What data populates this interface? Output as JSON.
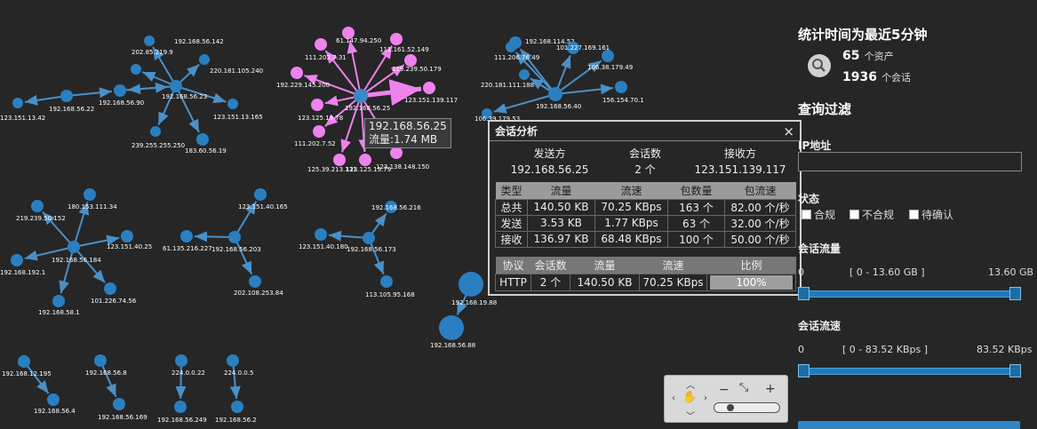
{
  "graph": {
    "nodes": [
      {
        "id": "n1",
        "label": "192.168.56.142",
        "color": "#2a7fc1"
      },
      {
        "id": "n2",
        "label": "202.85.219.9",
        "color": "#2a7fc1"
      },
      {
        "id": "n3",
        "label": "220.181.105.240",
        "color": "#2a7fc1"
      },
      {
        "id": "n4",
        "label": "192.168.56.23",
        "color": "#2a7fc1"
      },
      {
        "id": "n5",
        "label": "192.168.56.90",
        "color": "#2a7fc1"
      },
      {
        "id": "n6",
        "label": "192.168.56.22",
        "color": "#2a7fc1"
      },
      {
        "id": "n7",
        "label": "123.151.13.42",
        "color": "#2a7fc1"
      },
      {
        "id": "n8",
        "label": "123.151.13.165",
        "color": "#2a7fc1"
      },
      {
        "id": "n9",
        "label": "239.255.255.250",
        "color": "#2a7fc1"
      },
      {
        "id": "n10",
        "label": "183.60.56.19",
        "color": "#2a7fc1"
      },
      {
        "id": "p0",
        "label": "192.168.56.25",
        "color": "#3a88c8"
      },
      {
        "id": "p1",
        "label": "61.147.94.250",
        "color": "#ee82ee"
      },
      {
        "id": "p2",
        "label": "111.161.52.149",
        "color": "#ee82ee"
      },
      {
        "id": "p3",
        "label": "111.202.7.31",
        "color": "#ee82ee"
      },
      {
        "id": "p4",
        "label": "219.239.50.179",
        "color": "#ee82ee"
      },
      {
        "id": "p5",
        "label": "192.229.145.200",
        "color": "#ee82ee"
      },
      {
        "id": "p6",
        "label": "123.151.139.117",
        "color": "#ee82ee"
      },
      {
        "id": "p7",
        "label": "123.125.19.78",
        "color": "#ee82ee"
      },
      {
        "id": "p8",
        "label": "111.202.7.52",
        "color": "#ee82ee"
      },
      {
        "id": "p9",
        "label": "125.39.213.131",
        "color": "#ee82ee"
      },
      {
        "id": "p10",
        "label": "123.125.19.79",
        "color": "#ee82ee"
      },
      {
        "id": "p11",
        "label": "123.138.148.150",
        "color": "#ee82ee"
      },
      {
        "id": "c0",
        "label": "192.168.56.40",
        "color": "#2a7fc1"
      },
      {
        "id": "c1",
        "label": "192.168.114.52",
        "color": "#2a7fc1"
      },
      {
        "id": "c2",
        "label": "111.206.76.49",
        "color": "#2a7fc1"
      },
      {
        "id": "c3",
        "label": "101.227.169.161",
        "color": "#2a7fc1"
      },
      {
        "id": "c4",
        "label": "106.38.179.49",
        "color": "#2a7fc1"
      },
      {
        "id": "c5",
        "label": "220.181.111.188",
        "color": "#2a7fc1"
      },
      {
        "id": "c6",
        "label": "156.154.70.1",
        "color": "#2a7fc1"
      },
      {
        "id": "c7",
        "label": "106.39.179.53",
        "color": "#2a7fc1"
      },
      {
        "id": "d0",
        "label": "192.168.56.184",
        "color": "#2a7fc1"
      },
      {
        "id": "d1",
        "label": "180.153.111.34",
        "color": "#2a7fc1"
      },
      {
        "id": "d2",
        "label": "219.239.50.152",
        "color": "#2a7fc1"
      },
      {
        "id": "d3",
        "label": "123.151.40.25",
        "color": "#2a7fc1"
      },
      {
        "id": "d4",
        "label": "192.168.192.1",
        "color": "#2a7fc1"
      },
      {
        "id": "d5",
        "label": "101.226.74.56",
        "color": "#2a7fc1"
      },
      {
        "id": "d6",
        "label": "192.168.58.1",
        "color": "#2a7fc1"
      },
      {
        "id": "e0",
        "label": "192.168.56.203",
        "color": "#2a7fc1"
      },
      {
        "id": "e1",
        "label": "123.151.40.165",
        "color": "#2a7fc1"
      },
      {
        "id": "e2",
        "label": "61.135.216.227",
        "color": "#2a7fc1"
      },
      {
        "id": "e3",
        "label": "202.108.253.84",
        "color": "#2a7fc1"
      },
      {
        "id": "f0",
        "label": "192.168.56.173",
        "color": "#2a7fc1"
      },
      {
        "id": "f1",
        "label": "192.168.56.216",
        "color": "#2a7fc1"
      },
      {
        "id": "f2",
        "label": "123.151.40.180",
        "color": "#2a7fc1"
      },
      {
        "id": "f3",
        "label": "113.105.95.168",
        "color": "#2a7fc1"
      },
      {
        "id": "g1",
        "label": "192.168.19.88",
        "color": "#2a7fc1"
      },
      {
        "id": "g2",
        "label": "192.168.56.88",
        "color": "#2a7fc1"
      },
      {
        "id": "h1",
        "label": "192.168.12.195",
        "color": "#2a7fc1"
      },
      {
        "id": "h2",
        "label": "192.168.56.4",
        "color": "#2a7fc1"
      },
      {
        "id": "h3",
        "label": "192.168.56.8",
        "color": "#2a7fc1"
      },
      {
        "id": "h4",
        "label": "192.168.56.169",
        "color": "#2a7fc1"
      },
      {
        "id": "h5",
        "label": "224.0.0.22",
        "color": "#2a7fc1"
      },
      {
        "id": "h6",
        "label": "192.168.56.249",
        "color": "#2a7fc1"
      },
      {
        "id": "h7",
        "label": "224.0.0.5",
        "color": "#2a7fc1"
      },
      {
        "id": "h8",
        "label": "192.168.56.2",
        "color": "#2a7fc1"
      }
    ],
    "edge_color": "#4a90c8",
    "highlight_color": "#ee82ee"
  },
  "tooltip": {
    "ip": "192.168.56.25",
    "traffic": "流量:1.74 MB"
  },
  "dialog": {
    "title": "会话分析",
    "close": "×",
    "summary_headers": [
      "发送方",
      "会话数",
      "接收方"
    ],
    "summary_values": [
      "192.168.56.25",
      "2 个",
      "123.151.139.117"
    ],
    "traffic_headers": [
      "类型",
      "流量",
      "流速",
      "包数量",
      "包流速"
    ],
    "traffic_rows": [
      [
        "总共",
        "140.50 KB",
        "70.25 KBps",
        "163 个",
        "82.00 个/秒"
      ],
      [
        "发送",
        "3.53 KB",
        "1.77 KBps",
        "63 个",
        "32.00 个/秒"
      ],
      [
        "接收",
        "136.97 KB",
        "68.48 KBps",
        "100 个",
        "50.00 个/秒"
      ]
    ],
    "protocol_headers": [
      "协议",
      "会话数",
      "流量",
      "流速",
      "比例"
    ],
    "protocol_rows": [
      [
        "HTTP",
        "2 个",
        "140.50 KB",
        "70.25 KBps",
        "100%"
      ]
    ],
    "ratio_fill": 1.0
  },
  "panel": {
    "stat_title": "统计时间为最近5分钟",
    "assets_count": "65",
    "assets_unit": "个资产",
    "sessions_count": "1936",
    "sessions_unit": "个会话",
    "filter_title": "查询过滤",
    "ip_label": "IP地址",
    "ip_value": "",
    "status_label": "状态",
    "status_options": [
      "合规",
      "不合规",
      "待确认"
    ],
    "traffic_label": "会话流量",
    "traffic_min": "0",
    "traffic_range": "[ 0 - 13.60 GB ]",
    "traffic_max": "13.60 GB",
    "speed_label": "会话流速",
    "speed_min": "0",
    "speed_range": "[ 0 - 83.52 KBps ]",
    "speed_max": "83.52 KBps"
  },
  "nav": {
    "minus": "−",
    "plus": "+"
  }
}
